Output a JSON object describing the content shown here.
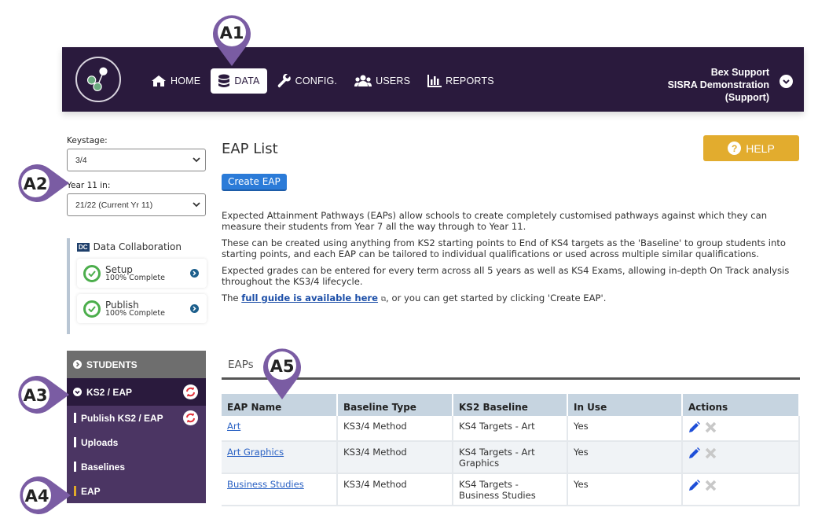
{
  "topnav": {
    "items": [
      {
        "label": "HOME",
        "icon": "home-icon",
        "active": false
      },
      {
        "label": "DATA",
        "icon": "database-icon",
        "active": true
      },
      {
        "label": "CONFIG.",
        "icon": "wrench-icon",
        "active": false
      },
      {
        "label": "USERS",
        "icon": "users-icon",
        "active": false
      },
      {
        "label": "REPORTS",
        "icon": "bar-chart-icon",
        "active": false
      }
    ],
    "user": {
      "name": "Bex Support",
      "org": "SISRA Demonstration",
      "role": "(Support)"
    }
  },
  "sidebar": {
    "keystage_label": "Keystage:",
    "keystage_value": "3/4",
    "year_label": "Year 11 in:",
    "year_value": "21/22 (Current Yr 11)",
    "dc": {
      "badge": "DC",
      "title": "Data Collaboration",
      "cards": [
        {
          "title": "Setup",
          "status": "100% Complete"
        },
        {
          "title": "Publish",
          "status": "100% Complete"
        }
      ]
    },
    "menu": {
      "students": "STUDENTS",
      "ks2_eap": "KS2 / EAP",
      "sub_items": [
        "Publish KS2 / EAP",
        "Uploads",
        "Baselines",
        "EAP"
      ],
      "active_item": "EAP"
    }
  },
  "main": {
    "title": "EAP List",
    "help_label": "HELP",
    "create_label": "Create EAP",
    "paragraphs": [
      "Expected Attainment Pathways (EAPs) allow schools to create completely customised pathways against which they can measure their students from Year 7 all the way through to Year 11.",
      "These can be created using anything from KS2 starting points to End of KS4 targets as the 'Baseline' to group students into starting points, and each EAP can be tailored to individual qualifications or used across multiple similar qualifications.",
      "Expected grades can be entered for every term across all 5 years as well as KS4 Exams, allowing in-depth On Track analysis throughout the KS3/4 lifecycle."
    ],
    "guide": {
      "prefix": "The ",
      "link": "full guide is available here",
      "ext_icon": "⧉",
      "suffix": ", or you can get started by clicking 'Create EAP'."
    },
    "tab": "EAPs",
    "table": {
      "headers": [
        "EAP Name",
        "Baseline Type",
        "KS2 Baseline",
        "In Use",
        "Actions"
      ],
      "rows": [
        {
          "name": "Art",
          "type": "KS3/4 Method",
          "baseline": "KS4 Targets - Art",
          "in_use": "Yes"
        },
        {
          "name": "Art Graphics",
          "type": "KS3/4 Method",
          "baseline": "KS4 Targets - Art Graphics",
          "in_use": "Yes"
        },
        {
          "name": "Business Studies",
          "type": "KS3/4 Method",
          "baseline": "KS4 Targets - Business Studies",
          "in_use": "Yes"
        }
      ]
    }
  },
  "callouts": [
    "A1",
    "A2",
    "A3",
    "A4",
    "A5"
  ],
  "colors": {
    "nav_bg": "#2a1a3d",
    "submenu_bg": "#4b3563",
    "callout": "#7a5ca3",
    "help": "#e2ac2e",
    "primary": "#2b7bd8",
    "active_marker": "#e0a92a"
  }
}
